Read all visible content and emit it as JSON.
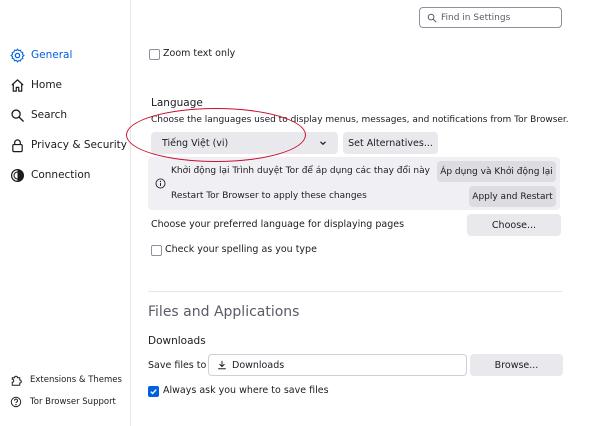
{
  "sidebar": {
    "items": [
      {
        "label": "General",
        "icon": "gear-icon",
        "selected": true
      },
      {
        "label": "Home",
        "icon": "home-icon"
      },
      {
        "label": "Search",
        "icon": "search-icon"
      },
      {
        "label": "Privacy & Security",
        "icon": "lock-icon"
      },
      {
        "label": "Connection",
        "icon": "onion-icon"
      }
    ],
    "footer": [
      {
        "label": "Extensions & Themes",
        "icon": "puzzle-icon"
      },
      {
        "label": "Tor Browser Support",
        "icon": "help-icon"
      }
    ]
  },
  "search": {
    "placeholder": "Find in Settings"
  },
  "zoom": {
    "label": "Zoom text only",
    "checked": false
  },
  "language": {
    "heading": "Language",
    "description": "Choose the languages used to display menus, messages, and notifications from Tor Browser.",
    "selected": "Tiếng Việt (vi)",
    "set_alternatives": "Set Alternatives...",
    "restart_line_vi": "Khởi động lại Trình duyệt Tor để áp dụng các thay đổi này",
    "restart_button_vi": "Áp dụng và Khởi động lại",
    "restart_line_en": "Restart Tor Browser to apply these changes",
    "restart_button_en": "Apply and Restart",
    "pages_label": "Choose your preferred language for displaying pages",
    "choose_button": "Choose...",
    "spelling_label": "Check your spelling as you type",
    "spelling_checked": false
  },
  "files": {
    "heading": "Files and Applications",
    "downloads_heading": "Downloads",
    "save_label": "Save files to",
    "save_path": "Downloads",
    "browse_button": "Browse...",
    "ask_label": "Always ask you where to save files",
    "ask_checked": true
  },
  "colors": {
    "accent": "#0061e0",
    "annotation": "#c8102e"
  }
}
